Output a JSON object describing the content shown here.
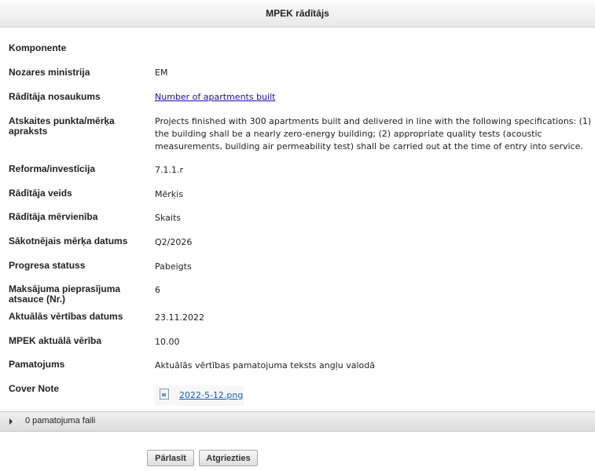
{
  "header": {
    "title": "MPEK rādītājs"
  },
  "fields": {
    "komponente": {
      "label": "Komponente",
      "value": ""
    },
    "ministrija": {
      "label": "Nozares ministrija",
      "value": "EM"
    },
    "nosaukums": {
      "label": "Rādītāja nosaukums",
      "value": "Number of apartments built"
    },
    "apraksts": {
      "label": "Atskaites punkta/mērķa apraksts",
      "value": "Projects finished with 300 apartments built and delivered in line with the following specifications: (1) the building shall be a nearly zero-energy building; (2) appropriate quality tests (acoustic measurements, building air permeability test) shall be carried out at the time of entry into service."
    },
    "reforma": {
      "label": "Reforma/investīcija",
      "value": "7.1.1.r"
    },
    "veids": {
      "label": "Rādītāja veids",
      "value": "Mērķis"
    },
    "mervieniba": {
      "label": "Rādītāja mērvienība",
      "value": "Skaits"
    },
    "sakotnejais": {
      "label": "Sākotnējais mērķa datums",
      "value": "Q2/2026"
    },
    "statuss": {
      "label": "Progresa statuss",
      "value": "Pabeigts"
    },
    "maksajums": {
      "label": "Maksājuma pieprasījuma atsauce (Nr.)",
      "value": "6"
    },
    "vertibas_datums": {
      "label": "Aktuālās vērtības datums",
      "value": "23.11.2022"
    },
    "aktuala_vertiba": {
      "label": "MPEK aktuālā vērība",
      "value": "10.00"
    },
    "pamatojums": {
      "label": "Pamatojums",
      "value": "Aktuālās vērtības pamatojuma teksts angļu valodā"
    },
    "cover_note": {
      "label": "Cover Note",
      "file_name": "2022-5-12.png"
    }
  },
  "attachments_bar": {
    "label": "0 pamatojuma faili"
  },
  "buttons": {
    "reload": "Pārlasīt",
    "back": "Atgriezties"
  }
}
